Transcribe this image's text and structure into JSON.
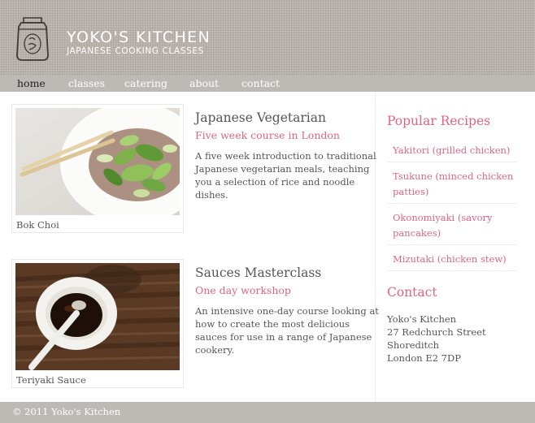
{
  "header": {
    "title": "YOKO'S KITCHEN",
    "subtitle": "JAPANESE COOKING CLASSES",
    "logo_icon": "bok-choi-jar-logo"
  },
  "nav": {
    "items": [
      {
        "label": "home",
        "current": true
      },
      {
        "label": "classes",
        "current": false
      },
      {
        "label": "catering",
        "current": false
      },
      {
        "label": "about",
        "current": false
      },
      {
        "label": "contact",
        "current": false
      }
    ]
  },
  "courses": [
    {
      "image_caption": "Bok Choi",
      "title": "Japanese Vegetarian",
      "subtitle": "Five week course in London",
      "description": "A five week introduction to traditional Japanese vegetarian meals, teaching you a selection of rice and noodle dishes."
    },
    {
      "image_caption": "Teriyaki Sauce",
      "title": "Sauces Masterclass",
      "subtitle": "One day workshop",
      "description": "An intensive one-day course looking at how to create the most delicious sauces for use in a range of Japanese cookery."
    }
  ],
  "sidebar": {
    "recipes_heading": "Popular Recipes",
    "recipes": [
      "Yakitori (grilled chicken)",
      "Tsukune (minced chicken patties)",
      "Okonomiyaki (savory pancakes)",
      "Mizutaki (chicken stew)"
    ],
    "contact_heading": "Contact",
    "address": [
      "Yoko's Kitchen",
      "27 Redchurch Street",
      "Shoreditch",
      "London E2 7DP"
    ]
  },
  "footer": {
    "text": "© 2011 Yoko's Kitchen"
  },
  "colors": {
    "accent": "#de6581",
    "header_bg": "#b9b4ad",
    "nav_bg": "#bcbab5",
    "text": "#555555"
  }
}
